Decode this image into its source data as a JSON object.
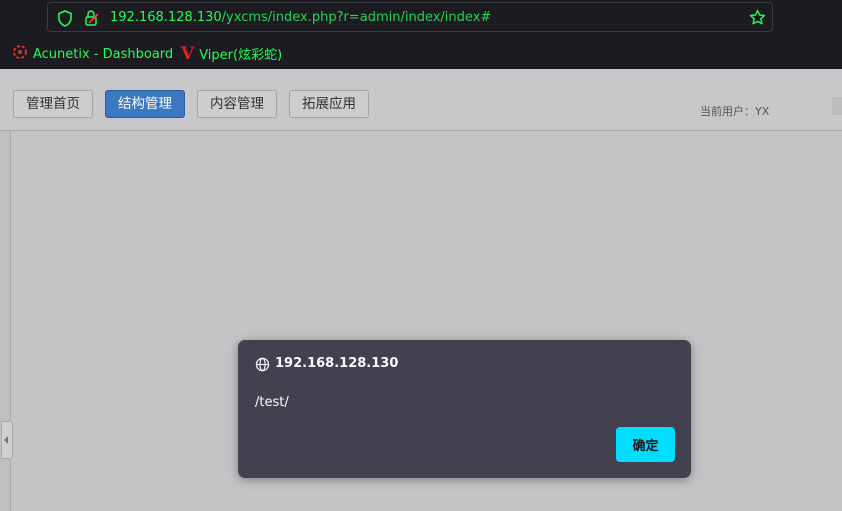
{
  "browser": {
    "url_host": "192.168.128.130",
    "url_path": "/yxcms/index.php?r=admin/index/index#",
    "icons": [
      "shield-icon",
      "lock-warning-icon",
      "star-icon"
    ],
    "bookmarks": [
      {
        "label": "Acunetix - Dashboard",
        "icon": "acunetix-icon"
      },
      {
        "label": "Viper(炫彩蛇)",
        "icon": "viper-icon"
      }
    ]
  },
  "header": {
    "nav": [
      {
        "label": "管理首页",
        "active": false
      },
      {
        "label": "结构管理",
        "active": true
      },
      {
        "label": "内容管理",
        "active": false
      },
      {
        "label": "拓展应用",
        "active": false
      }
    ],
    "current_user": "当前用户：YX"
  },
  "dialog": {
    "origin": "192.168.128.130",
    "message": "/test/",
    "ok_label": "确定",
    "icon": "globe-icon"
  },
  "colors": {
    "url_accent": "#21ff55",
    "active_nav": "#3a78c0",
    "dialog_bg": "#42414d",
    "ok_button": "#00ddff"
  }
}
